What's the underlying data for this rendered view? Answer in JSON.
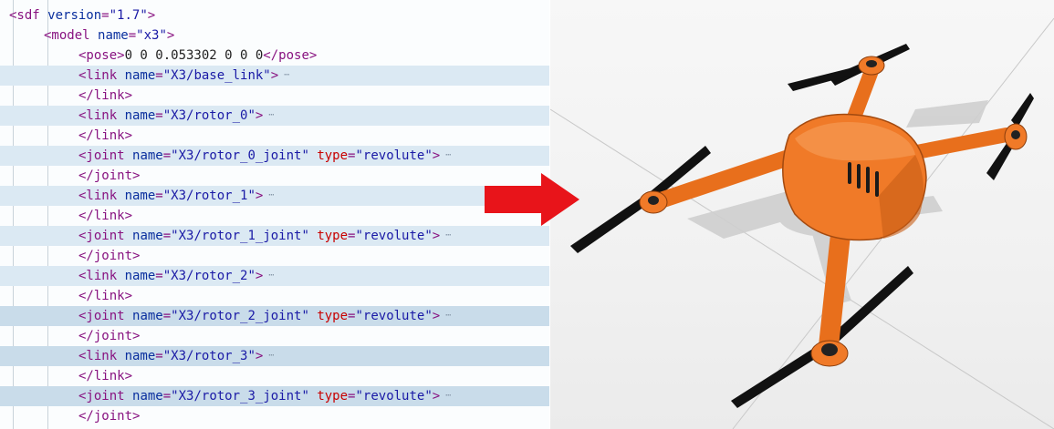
{
  "editor": {
    "lines": [
      {
        "indent": 0,
        "hl": "",
        "parts": [
          [
            "t",
            "<sdf "
          ],
          [
            "a",
            "version"
          ],
          [
            "t",
            "="
          ],
          [
            "v",
            "\"1.7\""
          ],
          [
            "t",
            ">"
          ]
        ]
      },
      {
        "indent": 1,
        "hl": "",
        "parts": [
          [
            "t",
            "<model "
          ],
          [
            "a",
            "name"
          ],
          [
            "t",
            "="
          ],
          [
            "v",
            "\"x3\""
          ],
          [
            "t",
            ">"
          ]
        ]
      },
      {
        "indent": 2,
        "hl": "",
        "parts": [
          [
            "t",
            "<pose>"
          ],
          [
            "txt",
            "0 0 0.053302 0 0 0"
          ],
          [
            "t",
            "</pose>"
          ]
        ]
      },
      {
        "indent": 2,
        "hl": "hl",
        "fold": true,
        "parts": [
          [
            "t",
            "<link "
          ],
          [
            "a",
            "name"
          ],
          [
            "t",
            "="
          ],
          [
            "v",
            "\"X3/base_link\""
          ],
          [
            "t",
            ">"
          ]
        ]
      },
      {
        "indent": 2,
        "hl": "",
        "parts": [
          [
            "t",
            "</link>"
          ]
        ]
      },
      {
        "indent": 2,
        "hl": "hl",
        "fold": true,
        "parts": [
          [
            "t",
            "<link "
          ],
          [
            "a",
            "name"
          ],
          [
            "t",
            "="
          ],
          [
            "v",
            "\"X3/rotor_0\""
          ],
          [
            "t",
            ">"
          ]
        ]
      },
      {
        "indent": 2,
        "hl": "",
        "parts": [
          [
            "t",
            "</link>"
          ]
        ]
      },
      {
        "indent": 2,
        "hl": "hl",
        "fold": true,
        "parts": [
          [
            "t",
            "<joint "
          ],
          [
            "a",
            "name"
          ],
          [
            "t",
            "="
          ],
          [
            "v",
            "\"X3/rotor_0_joint\""
          ],
          [
            "txt",
            " "
          ],
          [
            "ak",
            "type"
          ],
          [
            "t",
            "="
          ],
          [
            "v",
            "\"revolute\""
          ],
          [
            "t",
            ">"
          ]
        ]
      },
      {
        "indent": 2,
        "hl": "",
        "parts": [
          [
            "t",
            "</joint>"
          ]
        ]
      },
      {
        "indent": 2,
        "hl": "hl",
        "fold": true,
        "parts": [
          [
            "t",
            "<link "
          ],
          [
            "a",
            "name"
          ],
          [
            "t",
            "="
          ],
          [
            "v",
            "\"X3/rotor_1\""
          ],
          [
            "t",
            ">"
          ]
        ]
      },
      {
        "indent": 2,
        "hl": "",
        "parts": [
          [
            "t",
            "</link>"
          ]
        ]
      },
      {
        "indent": 2,
        "hl": "hl",
        "fold": true,
        "parts": [
          [
            "t",
            "<joint "
          ],
          [
            "a",
            "name"
          ],
          [
            "t",
            "="
          ],
          [
            "v",
            "\"X3/rotor_1_joint\""
          ],
          [
            "txt",
            " "
          ],
          [
            "ak",
            "type"
          ],
          [
            "t",
            "="
          ],
          [
            "v",
            "\"revolute\""
          ],
          [
            "t",
            ">"
          ]
        ]
      },
      {
        "indent": 2,
        "hl": "",
        "parts": [
          [
            "t",
            "</joint>"
          ]
        ]
      },
      {
        "indent": 2,
        "hl": "hl",
        "fold": true,
        "parts": [
          [
            "t",
            "<link "
          ],
          [
            "a",
            "name"
          ],
          [
            "t",
            "="
          ],
          [
            "v",
            "\"X3/rotor_2\""
          ],
          [
            "t",
            ">"
          ]
        ]
      },
      {
        "indent": 2,
        "hl": "",
        "parts": [
          [
            "t",
            "</link>"
          ]
        ]
      },
      {
        "indent": 2,
        "hl": "hl2",
        "fold": true,
        "parts": [
          [
            "t",
            "<joint "
          ],
          [
            "a",
            "name"
          ],
          [
            "t",
            "="
          ],
          [
            "v",
            "\"X3/rotor_2_joint\""
          ],
          [
            "txt",
            " "
          ],
          [
            "ak",
            "type"
          ],
          [
            "t",
            "="
          ],
          [
            "v",
            "\"revolute\""
          ],
          [
            "t",
            ">"
          ]
        ]
      },
      {
        "indent": 2,
        "hl": "",
        "parts": [
          [
            "t",
            "</joint>"
          ]
        ]
      },
      {
        "indent": 2,
        "hl": "hl2",
        "fold": true,
        "parts": [
          [
            "t",
            "<link "
          ],
          [
            "a",
            "name"
          ],
          [
            "t",
            "="
          ],
          [
            "v",
            "\"X3/rotor_3\""
          ],
          [
            "t",
            ">"
          ]
        ]
      },
      {
        "indent": 2,
        "hl": "",
        "parts": [
          [
            "t",
            "</link>"
          ]
        ]
      },
      {
        "indent": 2,
        "hl": "hl2",
        "fold": true,
        "parts": [
          [
            "t",
            "<joint "
          ],
          [
            "a",
            "name"
          ],
          [
            "t",
            "="
          ],
          [
            "v",
            "\"X3/rotor_3_joint\""
          ],
          [
            "txt",
            " "
          ],
          [
            "ak",
            "type"
          ],
          [
            "t",
            "="
          ],
          [
            "v",
            "\"revolute\""
          ],
          [
            "t",
            ">"
          ]
        ]
      },
      {
        "indent": 2,
        "hl": "",
        "parts": [
          [
            "t",
            "</joint>"
          ]
        ]
      }
    ],
    "fold_glyph": "⋯"
  },
  "arrow": {
    "color": "#e8141a",
    "icon": "arrow-right-icon"
  },
  "viewport": {
    "model_color": "#f07a28",
    "icon": "quadcopter-drone-model"
  }
}
